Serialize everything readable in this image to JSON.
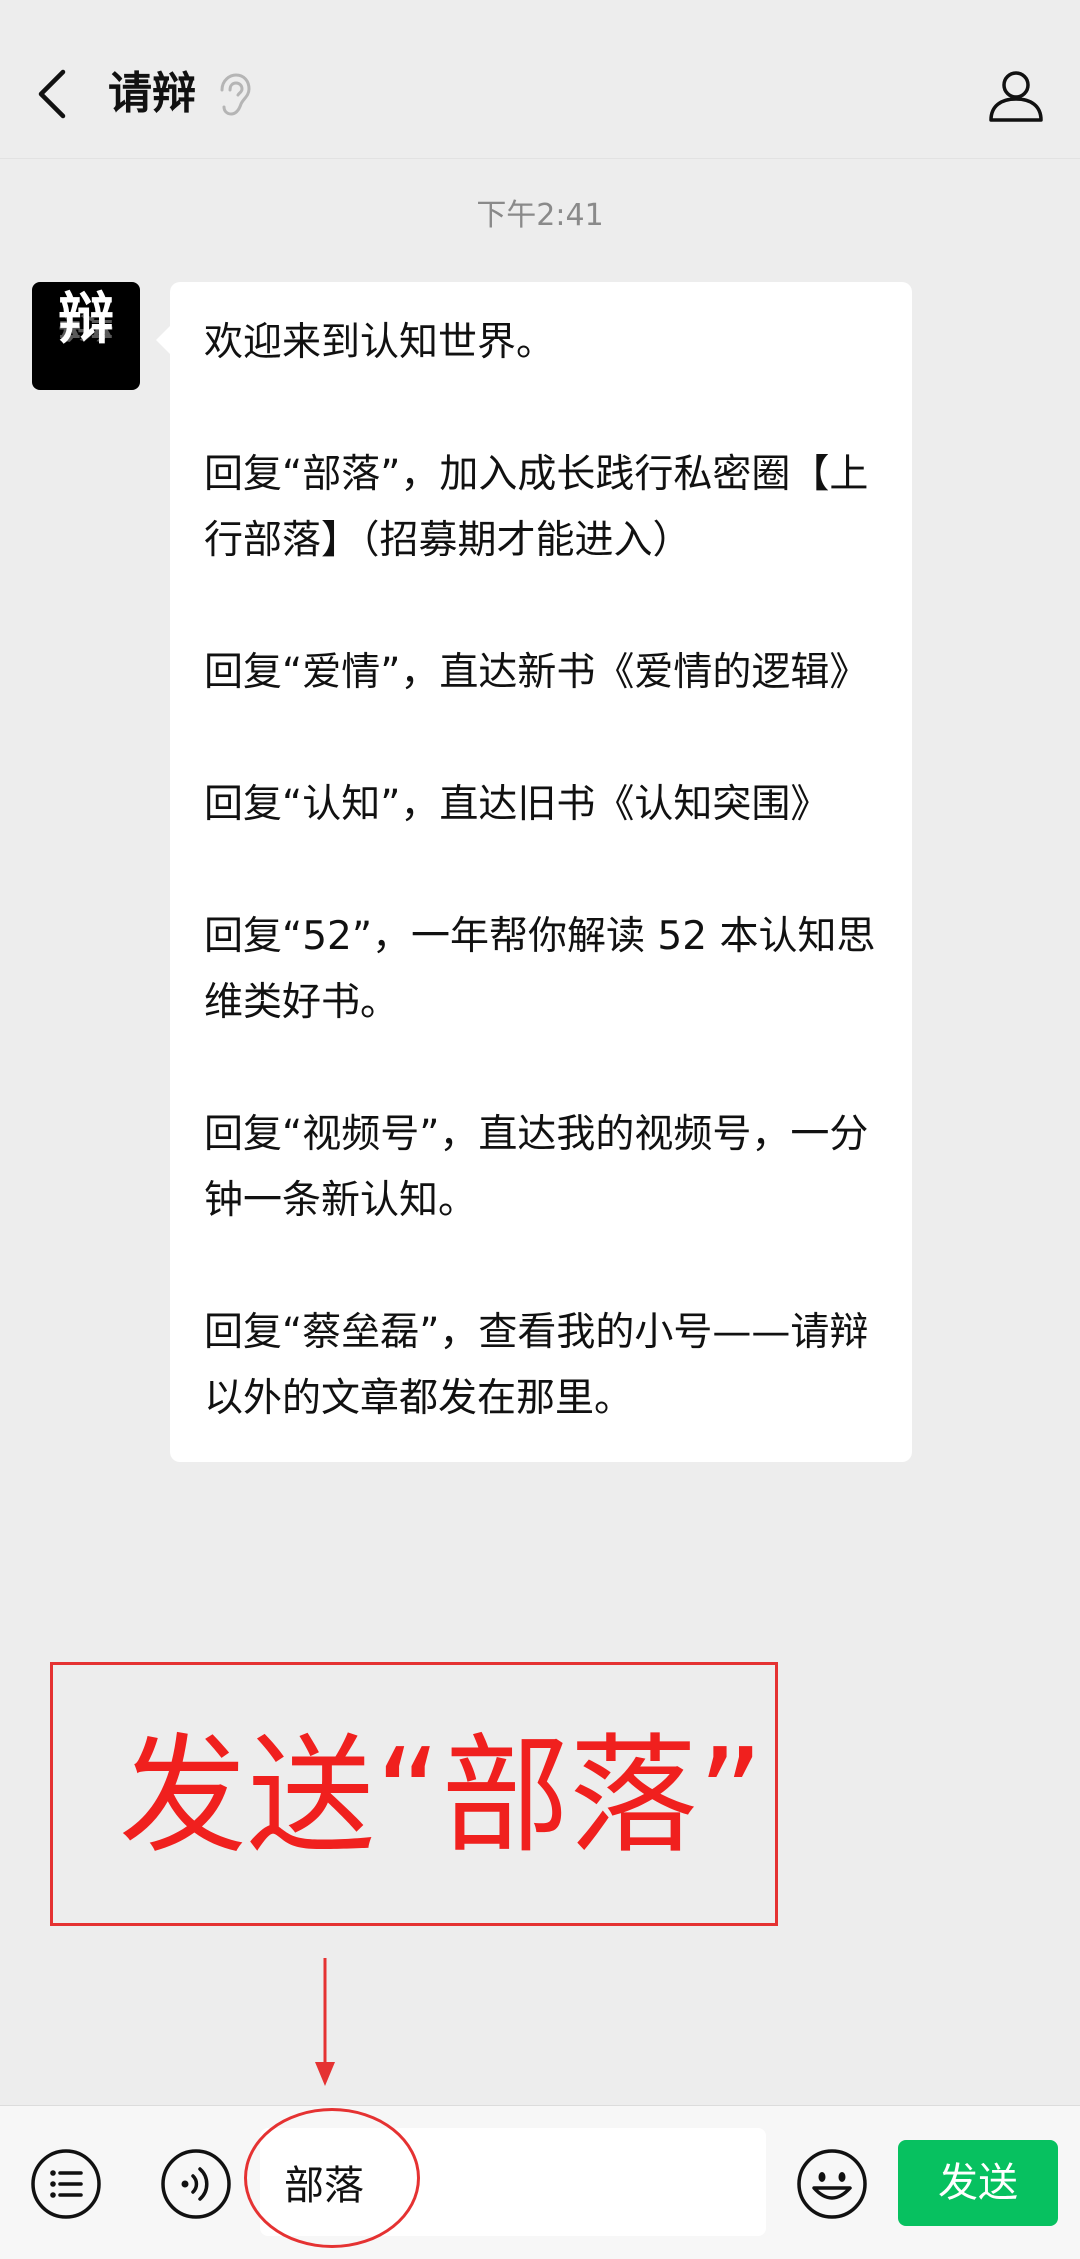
{
  "header": {
    "title": "请辩",
    "back_icon": "chevron-left-icon",
    "ear_icon": "ear-icon",
    "profile_icon": "person-icon"
  },
  "chat": {
    "timestamp": "下午2:41",
    "avatar_char": "辩",
    "message": {
      "paragraphs": [
        "欢迎来到认知世界。",
        "回复“部落”，加入成长践行私密圈【上行部落】（招募期才能进入）",
        "回复“爱情”，直达新书《爱情的逻辑》",
        "回复“认知”，直达旧书《认知突围》",
        "回复“52”，一年帮你解读 52 本认知思维类好书。",
        "回复“视频号”，直达我的视频号，一分钟一条新认知。",
        "回复“蔡垒磊”，查看我的小号——请辩以外的文章都发在那里。"
      ]
    }
  },
  "annotation": {
    "text": "发送“部落”",
    "color": "#f0201e"
  },
  "input_bar": {
    "menu_icon": "list-menu-icon",
    "voice_icon": "voice-icon",
    "input_value": "部落",
    "emoji_icon": "emoji-icon",
    "send_label": "发送",
    "send_color": "#07c160"
  }
}
